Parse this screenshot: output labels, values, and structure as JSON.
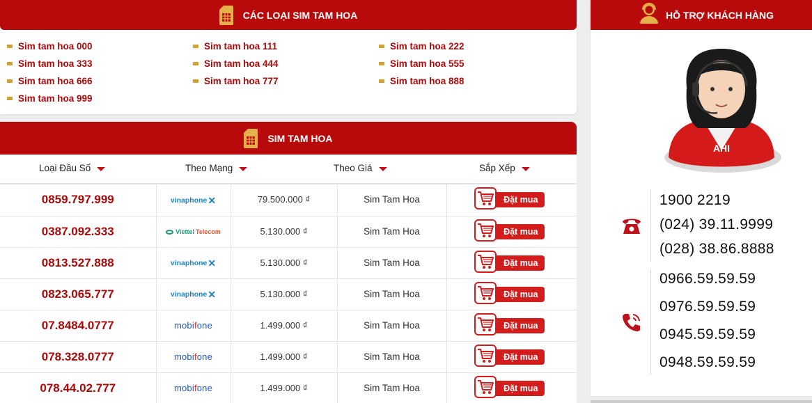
{
  "categories": {
    "title": "CÁC LOẠI SIM TAM HOA",
    "items": [
      "Sim tam hoa 000",
      "Sim tam hoa 111",
      "Sim tam hoa 222",
      "Sim tam hoa 333",
      "Sim tam hoa 444",
      "Sim tam hoa 555",
      "Sim tam hoa 666",
      "Sim tam hoa 777",
      "Sim tam hoa 888",
      "Sim tam hoa 999"
    ]
  },
  "list": {
    "title": "SIM TAM HOA",
    "filters": [
      "Loại Đầu Số",
      "Theo Mạng",
      "Theo Giá",
      "Sắp Xếp"
    ],
    "buy_label": "Đặt mua",
    "rows": [
      {
        "number": "0859.797.999",
        "network": "vinaphone",
        "price": "79.500.000 ₫",
        "type": "Sim Tam Hoa"
      },
      {
        "number": "0387.092.333",
        "network": "viettel",
        "price": "5.130.000 ₫",
        "type": "Sim Tam Hoa"
      },
      {
        "number": "0813.527.888",
        "network": "vinaphone",
        "price": "5.130.000 ₫",
        "type": "Sim Tam Hoa"
      },
      {
        "number": "0823.065.777",
        "network": "vinaphone",
        "price": "5.130.000 ₫",
        "type": "Sim Tam Hoa"
      },
      {
        "number": "07.8484.0777",
        "network": "mobifone",
        "price": "1.499.000 ₫",
        "type": "Sim Tam Hoa"
      },
      {
        "number": "078.328.0777",
        "network": "mobifone",
        "price": "1.499.000 ₫",
        "type": "Sim Tam Hoa"
      },
      {
        "number": "078.44.02.777",
        "network": "mobifone",
        "price": "1.499.000 ₫",
        "type": "Sim Tam Hoa"
      }
    ],
    "logos": {
      "vinaphone": "vinaphone",
      "viettel_a": "Viettel",
      "viettel_b": "Telecom",
      "mobifone_a": "mobi",
      "mobifone_b": "f",
      "mobifone_c": "one"
    }
  },
  "support": {
    "title": "HỖ TRỢ KHÁCH HÀNG",
    "badge": "AHI",
    "landlines": [
      "1900 2219",
      "(024) 39.11.9999",
      "(028) 38.86.8888"
    ],
    "mobiles": [
      "0966.59.59.59",
      "0976.59.59.59",
      "0945.59.59.59",
      "0948.59.59.59"
    ]
  },
  "colors": {
    "brand_red": "#b80a0a",
    "accent_red": "#d31c1c",
    "bullet_gold": "#d0a233"
  }
}
